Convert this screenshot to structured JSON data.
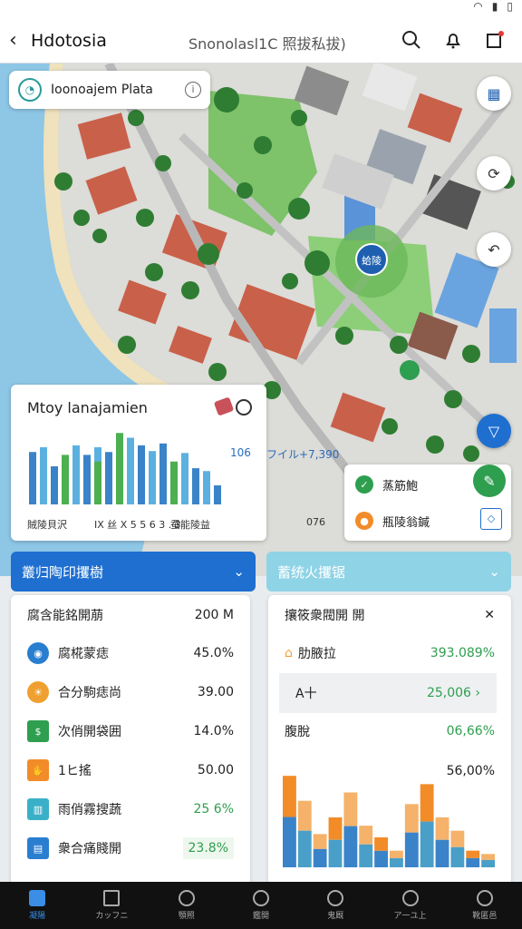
{
  "header": {
    "title": "Hdotosia",
    "subtitle": "Snonolasl1C 照拔私拔)"
  },
  "location_card": {
    "label": "Ioonoajem Plata"
  },
  "map": {
    "marker_label": "蛤陵"
  },
  "chart_card": {
    "title": "Mtoy lanajamien",
    "footer_left": "賊陵貝沢",
    "footer_mid": "IX 丝 X 5 5 6 3 . 3",
    "footer_right": "蚕能陵益",
    "side_val_1": "106",
    "side_val_2": "フイル+7,390",
    "side_foot": "076"
  },
  "chart_data": {
    "type": "bar",
    "title": "Mtoy lanajamien",
    "series": [
      {
        "name": "",
        "values": [
          55,
          60,
          40,
          52,
          62,
          52,
          60,
          55,
          68,
          70,
          62,
          56,
          64,
          45,
          54,
          38,
          35,
          20
        ]
      },
      {
        "name": "",
        "values": [
          0,
          0,
          0,
          0,
          0,
          0,
          45,
          0,
          75,
          0,
          0,
          0,
          0,
          0,
          0,
          0,
          0,
          0
        ]
      }
    ],
    "colors": [
      "#3a83c9",
      "#5cb0e0",
      "#4caf50",
      "#f28c28"
    ]
  },
  "legend": [
    {
      "label": "蒸筋鮑",
      "color": "#2e9e4f"
    },
    {
      "label": "瓶陵翁鍼",
      "color": "#f28c28"
    }
  ],
  "left_panel": {
    "head": "叢归陶印攫樹",
    "header_row": {
      "label": "腐含能銘開萠",
      "value": "200 M"
    },
    "rows": [
      {
        "label": "腐椛蒙痣",
        "value": "45.0%",
        "icon_color": "#2a7ed0"
      },
      {
        "label": "合分駒痣尚",
        "value": "39.00",
        "icon_color": "#f0a030"
      },
      {
        "label": "次俏開袋囲",
        "value": "14.0%",
        "icon_color": "#2e9e4f"
      },
      {
        "label": "1ヒ搖",
        "value": "50.00",
        "icon_color": "#f28c28"
      },
      {
        "label": "雨俏霧搜蔬",
        "value": "25 6%",
        "icon_color": "#3ab0c8"
      },
      {
        "label": "衆合痛賤開",
        "value": "23.8%",
        "icon_color": "#2a7ed0"
      }
    ]
  },
  "right_panel": {
    "head": "蓄统火攫锯",
    "header_row": {
      "label": "攘筱衆閥開 開",
      "value": "✕"
    },
    "rows": [
      {
        "label": "肋腋拉",
        "value": "393.089%"
      },
      {
        "label": "A十",
        "value": "25,006 ›"
      },
      {
        "label": "腹脫",
        "value": "06,66%"
      },
      {
        "label": "",
        "value": "56,00%"
      }
    ],
    "mini_chart": [
      55,
      40,
      20,
      30,
      45,
      25,
      18,
      10,
      38,
      50,
      30,
      22,
      10,
      8
    ]
  },
  "bottom_nav": [
    {
      "label": "凝陽",
      "active": true
    },
    {
      "label": "カッフニ"
    },
    {
      "label": "顎照"
    },
    {
      "label": "鑑開"
    },
    {
      "label": "鬼厩"
    },
    {
      "label": "ア一ユ上"
    },
    {
      "label": "靴匿邑"
    }
  ]
}
